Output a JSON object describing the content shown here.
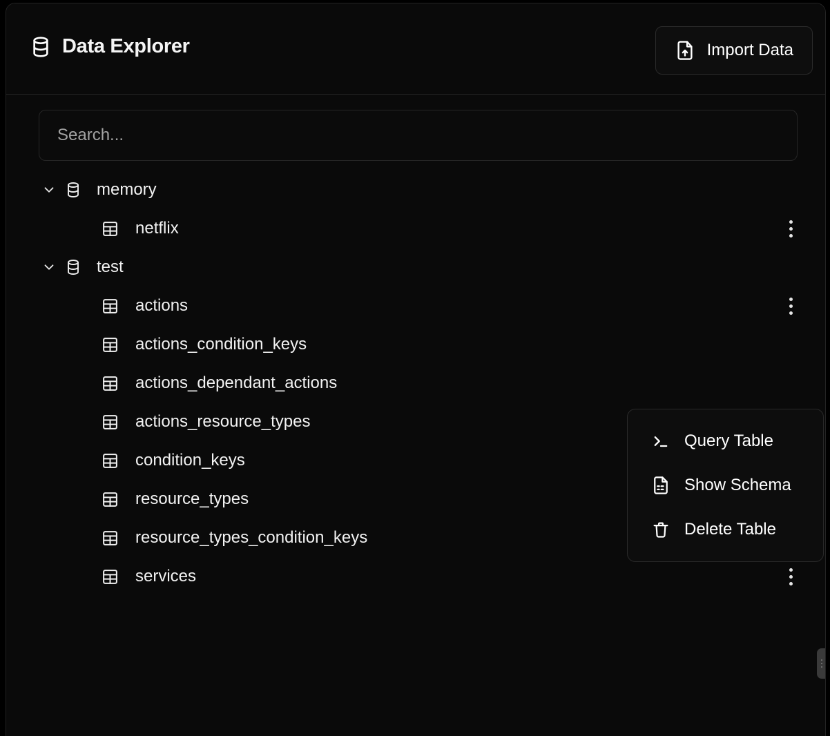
{
  "header": {
    "title": "Data Explorer",
    "title_icon": "database-icon",
    "import_button": {
      "label": "Import Data",
      "icon": "file-upload-icon"
    }
  },
  "search": {
    "placeholder": "Search...",
    "value": ""
  },
  "tree": {
    "databases": [
      {
        "name": "memory",
        "icon": "database-icon",
        "expanded": true,
        "chevron": "chevron-down-icon",
        "tables": [
          {
            "name": "netflix",
            "icon": "table-icon",
            "menu_icon": "kebab-menu-icon"
          }
        ]
      },
      {
        "name": "test",
        "icon": "database-icon",
        "expanded": true,
        "chevron": "chevron-down-icon",
        "tables": [
          {
            "name": "actions",
            "icon": "table-icon",
            "menu_icon": "kebab-menu-icon"
          },
          {
            "name": "actions_condition_keys",
            "icon": "table-icon",
            "menu_icon": "kebab-menu-icon"
          },
          {
            "name": "actions_dependant_actions",
            "icon": "table-icon",
            "menu_icon": "kebab-menu-icon"
          },
          {
            "name": "actions_resource_types",
            "icon": "table-icon",
            "menu_icon": "kebab-menu-icon"
          },
          {
            "name": "condition_keys",
            "icon": "table-icon",
            "menu_icon": "kebab-menu-icon"
          },
          {
            "name": "resource_types",
            "icon": "table-icon",
            "menu_icon": "kebab-menu-icon"
          },
          {
            "name": "resource_types_condition_keys",
            "icon": "table-icon",
            "menu_icon": "kebab-menu-icon"
          },
          {
            "name": "services",
            "icon": "table-icon",
            "menu_icon": "kebab-menu-icon"
          }
        ]
      }
    ]
  },
  "context_menu": {
    "open": true,
    "for_table": "actions",
    "items": [
      {
        "label": "Query Table",
        "icon": "terminal-icon"
      },
      {
        "label": "Show Schema",
        "icon": "file-schema-icon"
      },
      {
        "label": "Delete Table",
        "icon": "trash-icon"
      }
    ]
  },
  "colors": {
    "background": "#000000",
    "panel": "#0a0a0a",
    "border": "#232323",
    "text": "#f2f2f2",
    "muted_text": "#a3a3a3",
    "menu_background": "#0d0d0d"
  }
}
